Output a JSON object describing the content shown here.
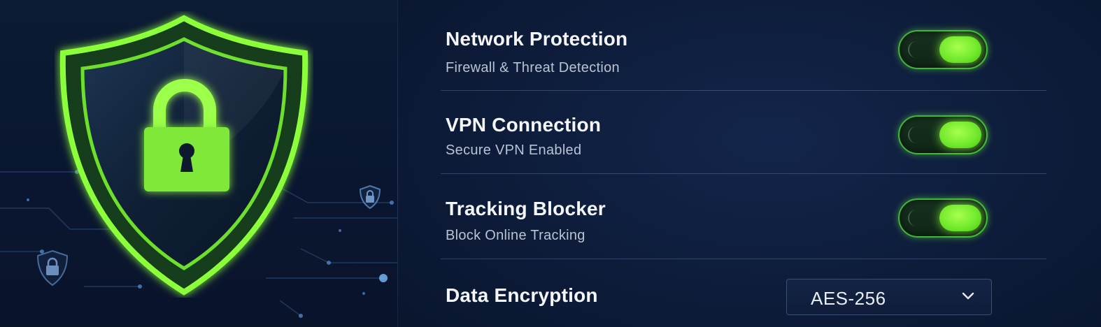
{
  "settings": [
    {
      "title": "Network Protection",
      "subtitle": "Firewall & Threat Detection",
      "enabled": true
    },
    {
      "title": "VPN Connection",
      "subtitle": "Secure VPN Enabled",
      "enabled": true
    },
    {
      "title": "Tracking Blocker",
      "subtitle": "Block Online Tracking",
      "enabled": true
    }
  ],
  "encryption": {
    "title": "Data Encryption",
    "selected": "AES-256"
  },
  "icons": {
    "hero": "shield-lock-icon",
    "small": "shield-lock-icon",
    "dropdown": "chevron-down-icon"
  },
  "colors": {
    "accent": "#7cf03a",
    "background": "#0c1a36",
    "text": "#f4f6fa",
    "subtext": "#b9c3d4"
  }
}
